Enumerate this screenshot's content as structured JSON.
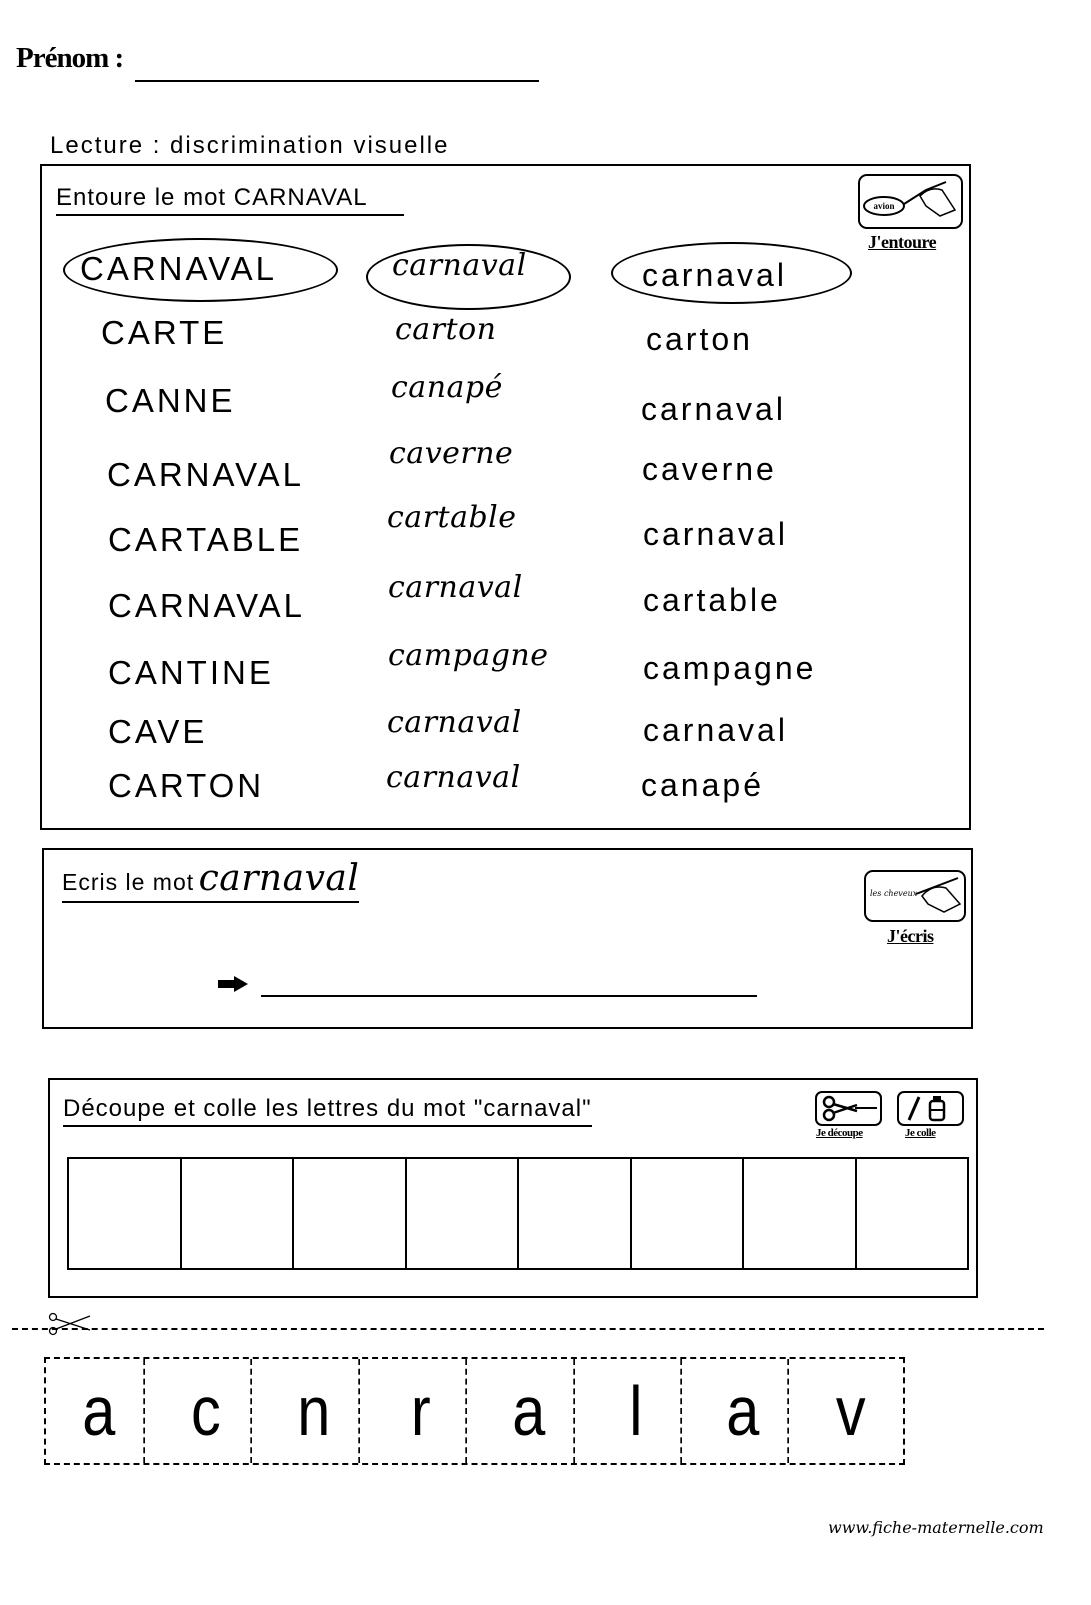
{
  "header": {
    "name_label": "Prénom :",
    "section_title": "Lecture : discrimination visuelle"
  },
  "exercise1": {
    "instruction": "Entoure le mot CARNAVAL",
    "icon_label": "J'entoure",
    "icon_inner_text": "avion",
    "target_word": "CARNAVAL",
    "columns": {
      "capitals": [
        "CARNAVAL",
        "CARTE",
        "CANNE",
        "CARNAVAL",
        "CARTABLE",
        "CARNAVAL",
        "CANTINE",
        "CAVE",
        "CARTON"
      ],
      "cursive": [
        "carnaval",
        "carton",
        "canapé",
        "caverne",
        "cartable",
        "carnaval",
        "campagne",
        "carnaval",
        "carnaval"
      ],
      "script": [
        "carnaval",
        "carton",
        "carnaval",
        "caverne",
        "carnaval",
        "cartable",
        "campagne",
        "carnaval",
        "canapé"
      ]
    },
    "circled_examples": [
      "CARNAVAL",
      "carnaval",
      "carnaval"
    ]
  },
  "exercise2": {
    "instruction_prefix": "Ecris le mot",
    "instruction_word": "carnaval",
    "icon_label": "J'écris",
    "icon_inner_text": "les cheveux",
    "answer_value": ""
  },
  "exercise3": {
    "instruction": "Découpe et colle les lettres du mot \"carnaval\"",
    "icon_cut_label": "Je découpe",
    "icon_glue_label": "Je colle",
    "cell_count": 8
  },
  "cutout_letters": [
    "a",
    "c",
    "n",
    "r",
    "a",
    "l",
    "a",
    "v"
  ],
  "footer": {
    "site": "www.fiche-maternelle.com"
  }
}
